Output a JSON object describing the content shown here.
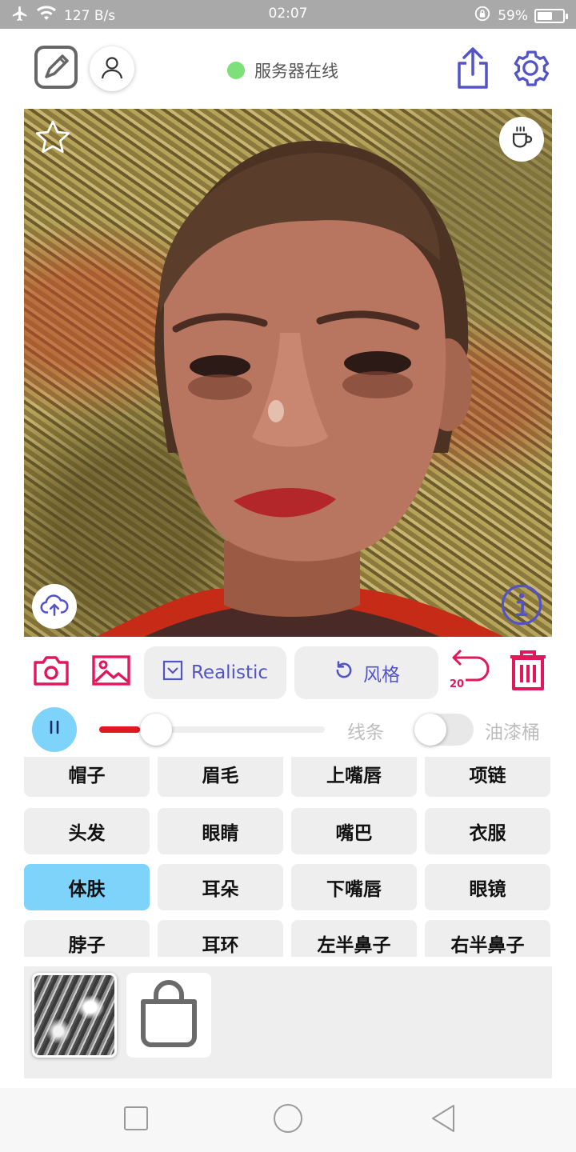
{
  "status_bar": {
    "network_speed": "127 B/s",
    "time": "02:07",
    "battery": "59%",
    "battery_level": 0.59
  },
  "header": {
    "server_status": "服务器在线",
    "status_color": "#7ee07a"
  },
  "toolbar": {
    "model_label": "Realistic",
    "style_label": "风格",
    "undo_count": "20",
    "accent_color": "#e0185a",
    "button_text_color": "#5353c8"
  },
  "controls": {
    "slider_value": 0.18,
    "lines_label": "线条",
    "bucket_label": "油漆桶",
    "bucket_toggle_on": false
  },
  "parts": {
    "items": [
      "帽子",
      "眉毛",
      "上嘴唇",
      "项链",
      "头发",
      "眼睛",
      "嘴巴",
      "衣服",
      "体肤",
      "耳朵",
      "下嘴唇",
      "眼镜",
      "脖子",
      "耳环",
      "左半鼻子",
      "右半鼻子"
    ],
    "selected": "体肤",
    "selected_color": "#7ed3fb"
  },
  "icons": {
    "header_left": [
      "sketch-icon",
      "user-icon"
    ],
    "header_right": [
      "share-icon",
      "settings-icon"
    ],
    "canvas_overlay": [
      "star-icon",
      "coffee-icon",
      "cloud-upload-icon",
      "info-icon"
    ],
    "tray": [
      "style-thumbnail",
      "shopping-bag-icon"
    ],
    "nav": [
      "recent-apps-icon",
      "home-icon",
      "back-icon"
    ]
  }
}
